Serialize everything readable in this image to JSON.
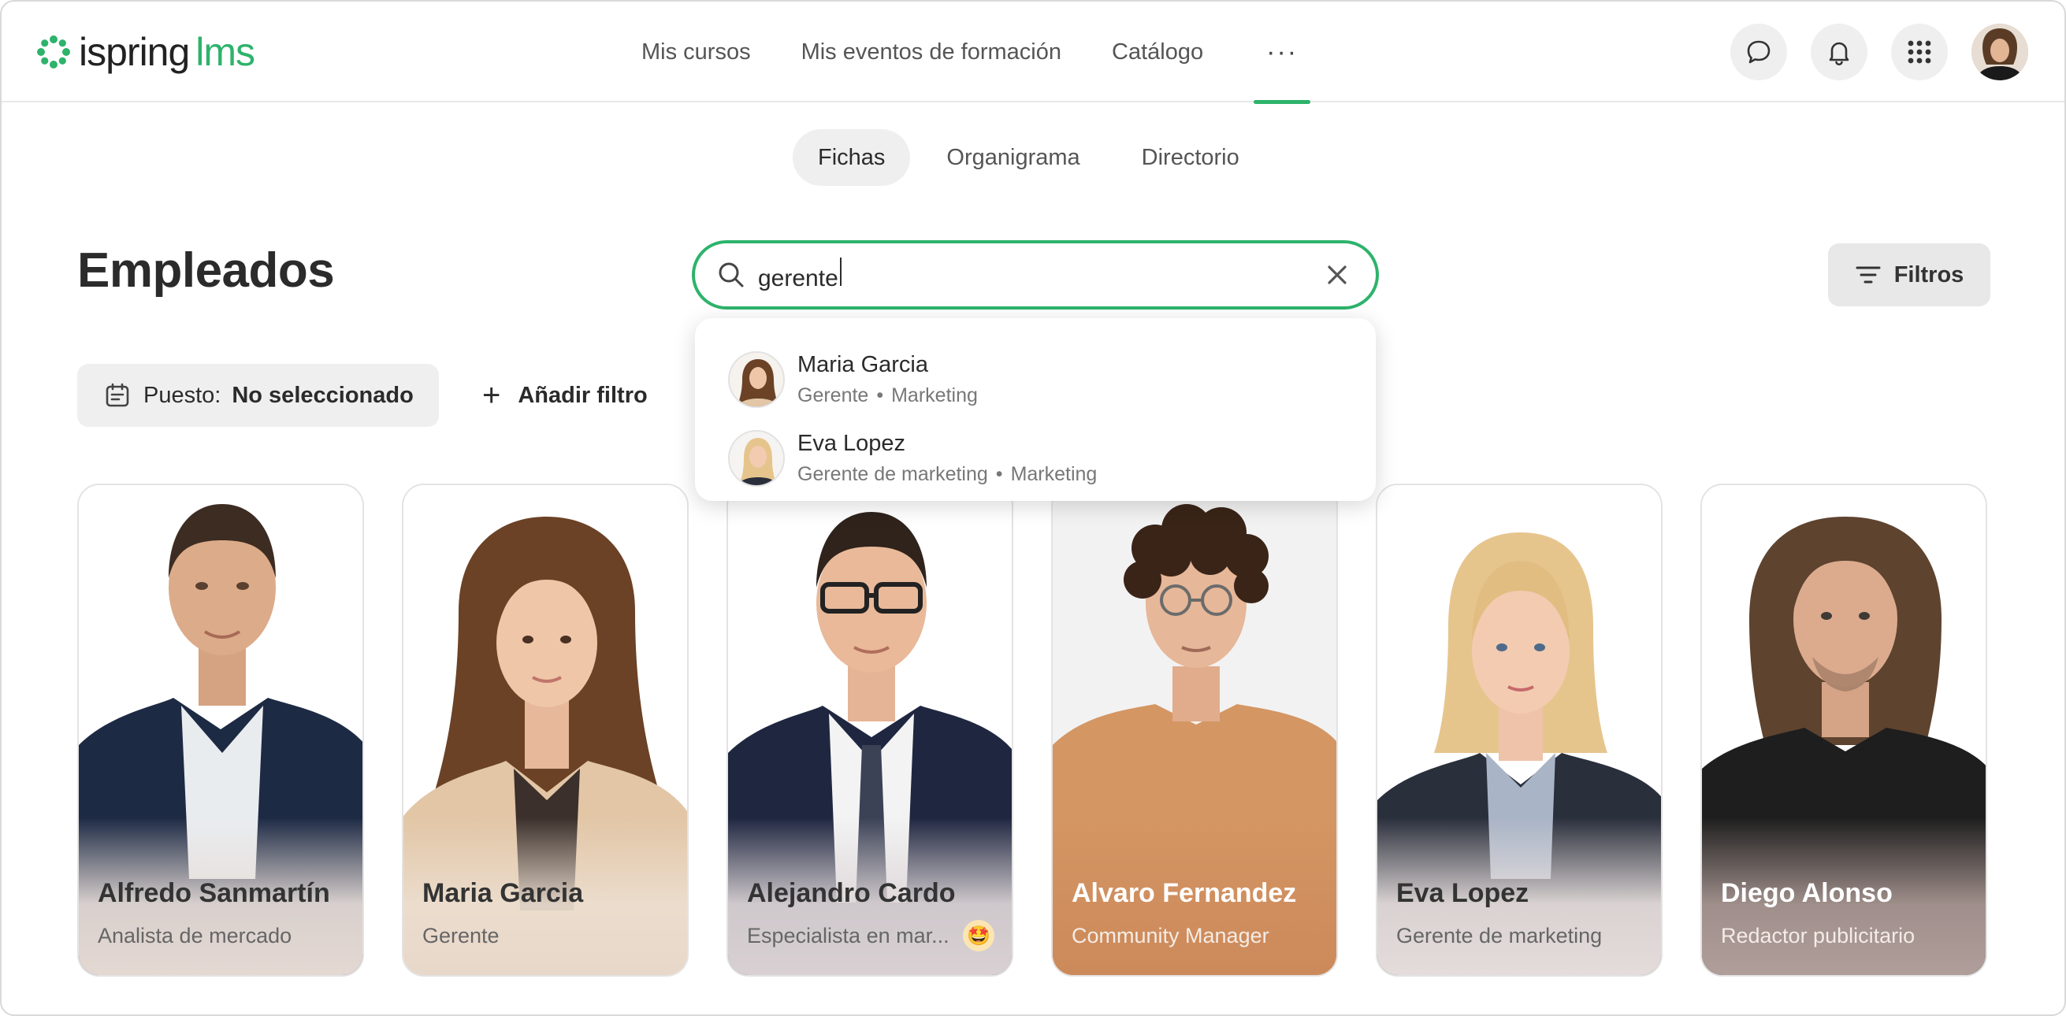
{
  "brand": {
    "name": "ispring",
    "product": "lms",
    "accent_color": "#2db36b"
  },
  "header": {
    "nav": [
      "Mis cursos",
      "Mis eventos de formación",
      "Catálogo"
    ],
    "more_label": "···",
    "icons": [
      "chat-icon",
      "bell-icon",
      "apps-grid-icon"
    ]
  },
  "subtabs": [
    "Fichas",
    "Organigrama",
    "Directorio"
  ],
  "page": {
    "title": "Empleados"
  },
  "search": {
    "value": "gerente"
  },
  "filters_button": {
    "label": "Filtros"
  },
  "position_filter": {
    "label": "Puesto:",
    "value": "No seleccionado"
  },
  "add_filter": {
    "label": "Añadir filtro"
  },
  "search_results": [
    {
      "name": "Maria Garcia",
      "role": "Gerente",
      "department": "Marketing"
    },
    {
      "name": "Eva Lopez",
      "role": "Gerente de marketing",
      "department": "Marketing"
    }
  ],
  "employees": [
    {
      "name": "Alfredo Sanmartín",
      "role": "Analista de mercado"
    },
    {
      "name": "Maria Garcia",
      "role": "Gerente"
    },
    {
      "name": "Alejandro Cardo",
      "role": "Especialista en mar...",
      "badge": "🤩"
    },
    {
      "name": "Alvaro Fernandez",
      "role": "Community Manager"
    },
    {
      "name": "Eva Lopez",
      "role": "Gerente de marketing"
    },
    {
      "name": "Diego Alonso",
      "role": "Redactor publicitario"
    }
  ]
}
